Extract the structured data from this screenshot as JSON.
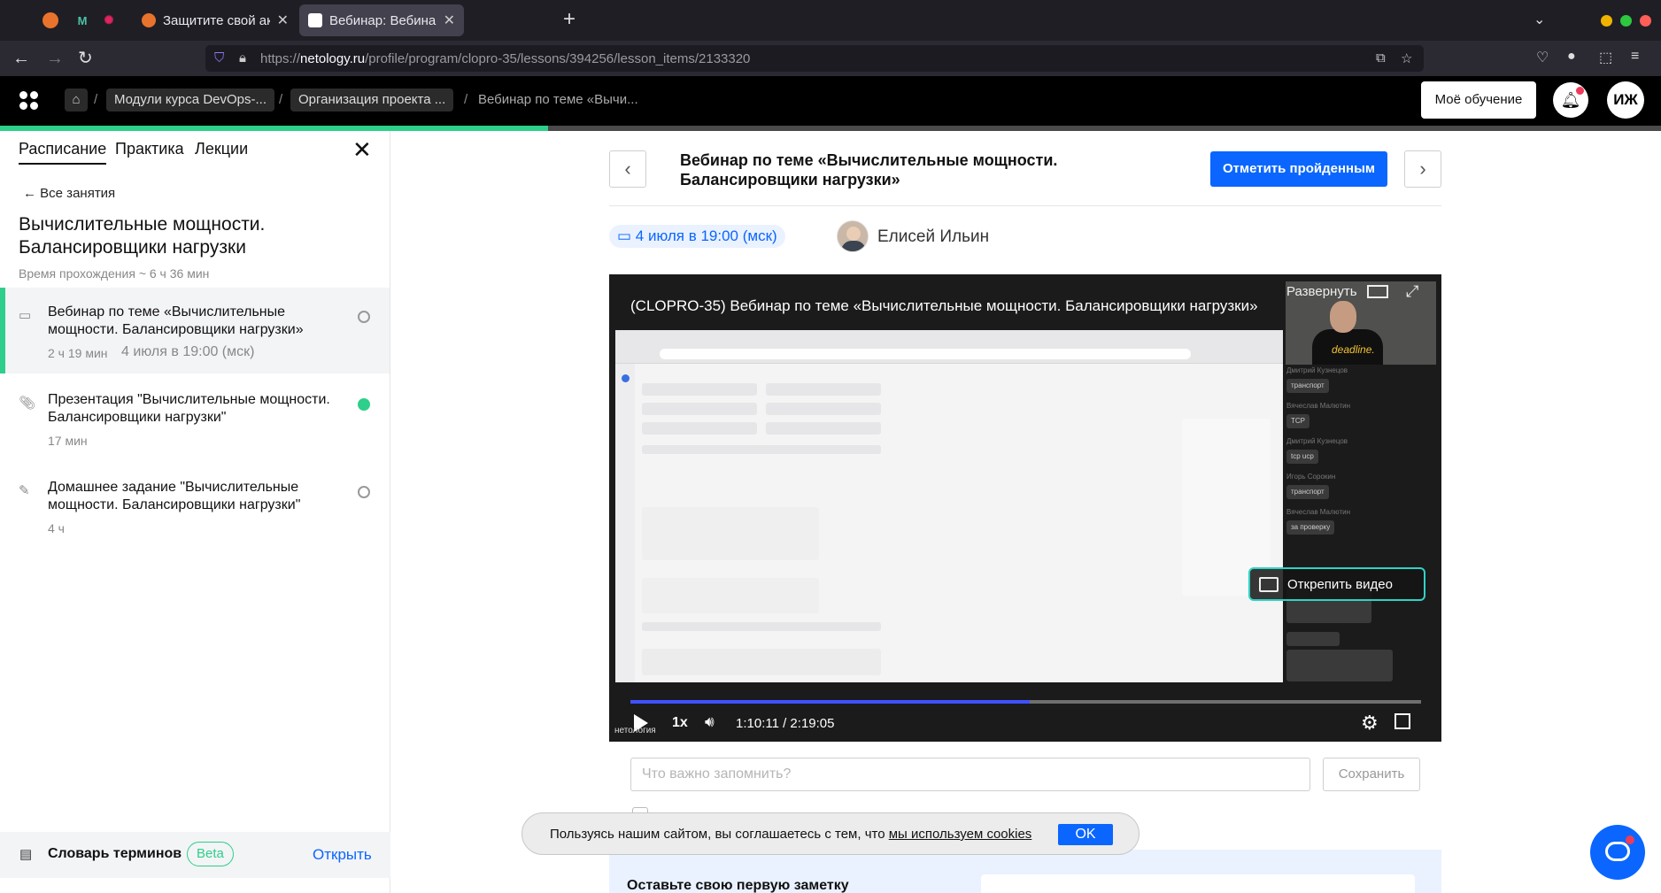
{
  "browser": {
    "tabs": [
      {
        "title": "Защитите свой аккаунт",
        "active": false
      },
      {
        "title": "Вебинар: Вебинар по теме",
        "active": true
      }
    ],
    "url_prefix": "https://",
    "url_domain": "netology.ru",
    "url_path": "/profile/program/clopro-35/lessons/394256/lesson_items/2133320"
  },
  "header": {
    "breadcrumbs": [
      "Модули курса DevOps-...",
      "Организация проекта ...",
      "Вебинар по теме «Вычи..."
    ],
    "my_learning": "Моё обучение",
    "avatar_initials": "ИЖ"
  },
  "course_progress": 0.33,
  "sidebar": {
    "tabs": [
      "Расписание",
      "Практика",
      "Лекции"
    ],
    "back_link": "Все занятия",
    "title": "Вычислительные мощности. Балансировщики нагрузки",
    "duration": "Время прохождения ~ 6 ч 36 мин",
    "lessons": [
      {
        "title": "Вебинар по теме «Вычислительные мощности. Балансировщики нагрузки»",
        "meta": "2 ч 19 мин",
        "date": "4 июля в 19:00 (мск)",
        "icon": "video-icon",
        "done": false
      },
      {
        "title": "Презентация \"Вычислительные мощности. Балансировщики нагрузки\"",
        "meta": "17 мин",
        "date": "",
        "icon": "paperclip-icon",
        "done": true
      },
      {
        "title": "Домашнее задание \"Вычислительные мощности. Балансировщики нагрузки\"",
        "meta": "4 ч",
        "date": "",
        "icon": "edit-icon",
        "done": false
      }
    ],
    "glossary": {
      "title": "Словарь терминов",
      "badge": "Beta",
      "open": "Открыть"
    }
  },
  "lesson": {
    "heading": "Вебинар по теме «Вычислительные мощности. Балансировщики нагрузки»",
    "mark_done": "Отметить пройденным",
    "date": "4 июля в 19:00 (мск)",
    "author": "Елисей Ильин"
  },
  "video": {
    "title": "(CLOPRO-35) Вебинар по теме «Вычислительные мощности. Балансировщики нагрузки»",
    "expand": "Развернуть",
    "unpin": "Открепить видео",
    "speed": "1x",
    "time": "1:10:11 / 2:19:05",
    "progress": 0.505,
    "brand": "нетология",
    "cam_text": "deadline.",
    "chat": [
      {
        "name": "Дмитрий Кузнецов",
        "msg": "транспорт"
      },
      {
        "name": "Вячеслав Малютин",
        "msg": "TCP"
      },
      {
        "name": "Дмитрий Кузнецов",
        "msg": "tcp ucp"
      },
      {
        "name": "Игорь Сорокин",
        "msg": "транспорт"
      },
      {
        "name": "Вячеслав Малютин",
        "msg": "за проверку"
      }
    ]
  },
  "notes": {
    "placeholder": "Что важно запомнить?",
    "save": "Сохранить",
    "heading": "Оставьте свою первую заметку"
  },
  "cookie": {
    "text": "Пользуясь нашим сайтом, вы соглашаетесь с тем, что ",
    "link": "мы используем cookies",
    "ok": "OK"
  }
}
